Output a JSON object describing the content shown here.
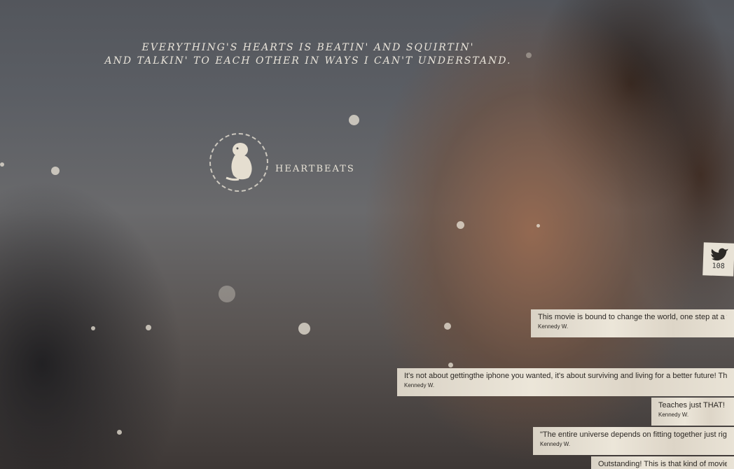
{
  "quote": {
    "line1": "EVERYTHING'S HEARTS IS BEATIN' AND SQUIRTIN'",
    "line2": "AND TALKIN' TO EACH OTHER IN WAYS I CAN'T UNDERSTAND."
  },
  "section": {
    "label": "HEARTBEATS"
  },
  "twitter": {
    "count": "108",
    "icon": "twitter-bird-icon"
  },
  "tweets": [
    {
      "text": "This movie is bound to change the world, one step at a time.",
      "author": "Kennedy W."
    },
    {
      "text": "It's not about gettingthe iphone you wanted, it's about surviving and living for a better future! This movie",
      "author": "Kennedy W."
    },
    {
      "text": "Teaches just THAT!",
      "author": "Kennedy W."
    },
    {
      "text": "\"The entire universe depends on fitting together just right.\"",
      "author": "Kennedy W."
    },
    {
      "text": "Outstanding!  This is that kind of movie.",
      "author": ""
    }
  ]
}
